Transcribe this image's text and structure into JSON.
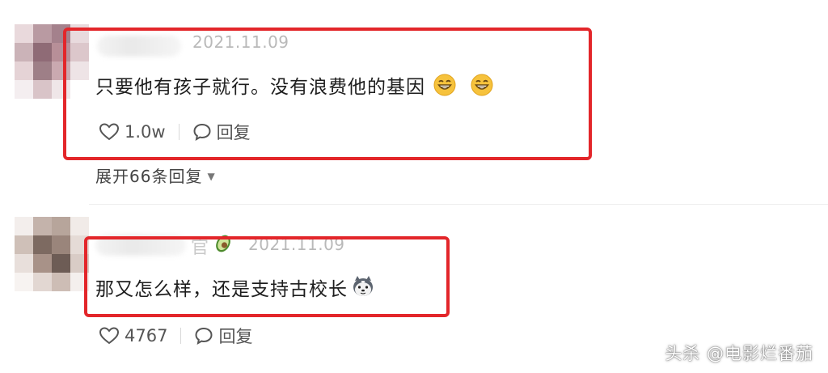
{
  "comments": [
    {
      "date": "2021.11.09",
      "text": "只要他有孩子就行。没有浪费他的基因",
      "emojis": [
        "grin-emoji",
        "grin-emoji"
      ],
      "likes": "1.0w",
      "reply_label": "回复",
      "expand_label": "展开66条回复"
    },
    {
      "name_suffix": "官",
      "badge": "avocado-icon",
      "date": "2021.11.09",
      "text": "那又怎么样，还是支持古校长",
      "emojis": [
        "husky-dog-emoji"
      ],
      "likes": "4767",
      "reply_label": "回复"
    }
  ],
  "watermark": "头杀 @电影烂番茄",
  "colors": {
    "highlight_box": "#e3262a",
    "date": "#b9b9b9"
  }
}
